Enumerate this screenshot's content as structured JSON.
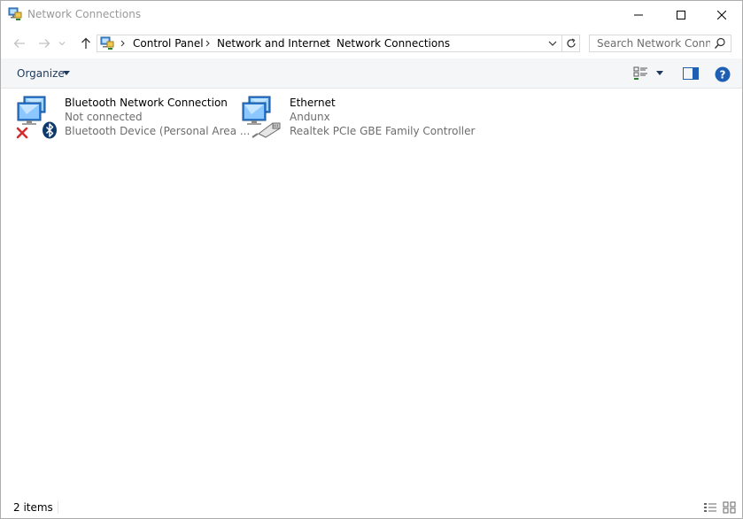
{
  "window": {
    "title": "Network Connections"
  },
  "address": {
    "crumbs": [
      "Control Panel",
      "Network and Internet",
      "Network Connections"
    ]
  },
  "search": {
    "placeholder": "Search Network Conn..."
  },
  "toolbar": {
    "organize_label": "Organize"
  },
  "items": [
    {
      "name": "Bluetooth Network Connection",
      "status": "Not connected",
      "device": "Bluetooth Device (Personal Area ...",
      "icon": "bluetooth-network-icon"
    },
    {
      "name": "Ethernet",
      "status": "Andunx",
      "device": "Realtek PCIe GBE Family Controller",
      "icon": "ethernet-network-icon"
    }
  ],
  "status": {
    "count": "2 items"
  },
  "colors": {
    "title_text": "#999999",
    "accent": "#1e5fb4",
    "subtext": "#6d6d6d",
    "error_red": "#d32f2f"
  }
}
